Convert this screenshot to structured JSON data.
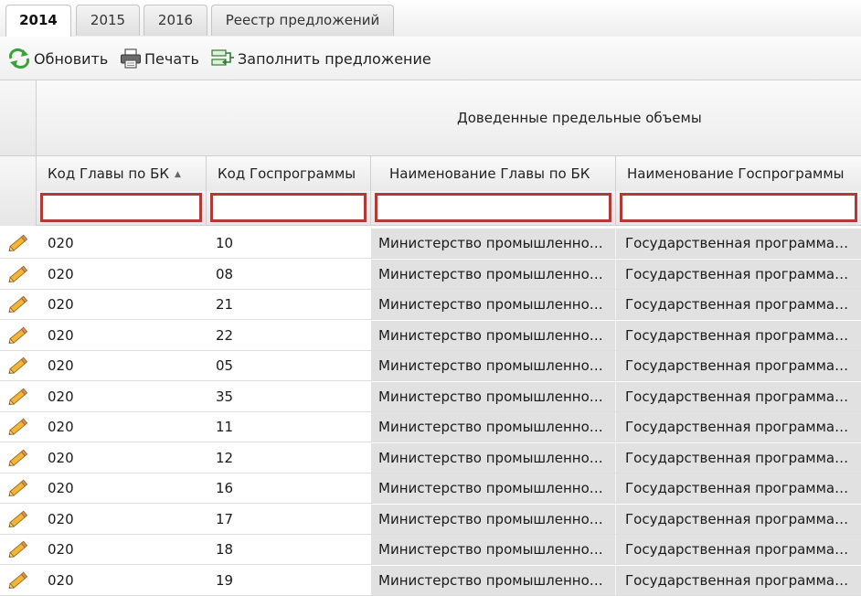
{
  "tabs": [
    {
      "label": "2014",
      "active": true
    },
    {
      "label": "2015",
      "active": false
    },
    {
      "label": "2016",
      "active": false
    },
    {
      "label": "Реестр предложений",
      "active": false
    }
  ],
  "toolbar": {
    "refresh_label": "Обновить",
    "print_label": "Печать",
    "fill_label": "Заполнить предложение"
  },
  "grid": {
    "group_header": "Доведенные предельные объемы",
    "columns": [
      {
        "label": "Код Главы по БК",
        "sorted": "asc"
      },
      {
        "label": "Код Госпрограммы"
      },
      {
        "label": "Наименование Главы по БК"
      },
      {
        "label": "Наименование Госпрограммы"
      }
    ],
    "filters": [
      "",
      "",
      "",
      ""
    ],
    "rows": [
      {
        "code": "020",
        "program": "10",
        "name": "Министерство промышленно…",
        "gp_name": "Государственная программа…"
      },
      {
        "code": "020",
        "program": "08",
        "name": "Министерство промышленно…",
        "gp_name": "Государственная программа…"
      },
      {
        "code": "020",
        "program": "21",
        "name": "Министерство промышленно…",
        "gp_name": "Государственная программа…"
      },
      {
        "code": "020",
        "program": "22",
        "name": "Министерство промышленно…",
        "gp_name": "Государственная программа…"
      },
      {
        "code": "020",
        "program": "05",
        "name": "Министерство промышленно…",
        "gp_name": "Государственная программа…"
      },
      {
        "code": "020",
        "program": "35",
        "name": "Министерство промышленно…",
        "gp_name": "Государственная программа…"
      },
      {
        "code": "020",
        "program": "11",
        "name": "Министерство промышленно…",
        "gp_name": "Государственная программа…"
      },
      {
        "code": "020",
        "program": "12",
        "name": "Министерство промышленно…",
        "gp_name": "Государственная программа…"
      },
      {
        "code": "020",
        "program": "16",
        "name": "Министерство промышленно…",
        "gp_name": "Государственная программа…"
      },
      {
        "code": "020",
        "program": "17",
        "name": "Министерство промышленно…",
        "gp_name": "Государственная программа…"
      },
      {
        "code": "020",
        "program": "18",
        "name": "Министерство промышленно…",
        "gp_name": "Государственная программа…"
      },
      {
        "code": "020",
        "program": "19",
        "name": "Министерство промышленно…",
        "gp_name": "Государственная программа…"
      }
    ]
  },
  "icons": {
    "refresh": "refresh-icon",
    "print": "printer-icon",
    "fill": "fill-proposal-icon",
    "edit": "pencil-icon",
    "sort": "sort-asc-icon"
  },
  "colors": {
    "filter_border": "#b23a36",
    "readonly_cell_bg": "#e1e1e1",
    "refresh_green": "#3aa23a"
  }
}
